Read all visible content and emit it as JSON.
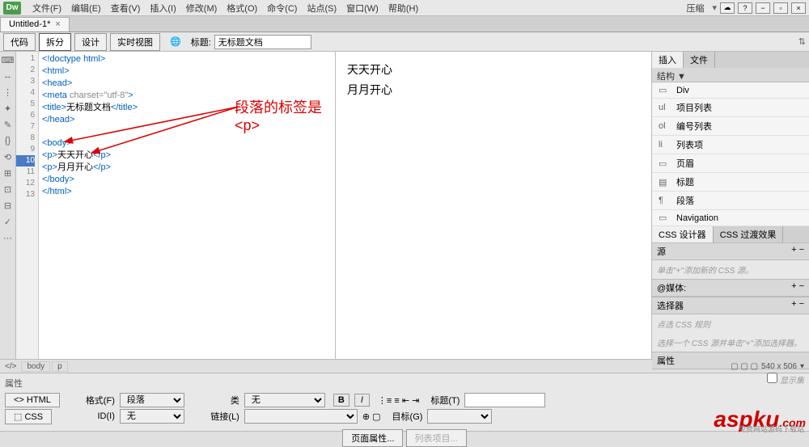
{
  "logo": "Dw",
  "menu": [
    "文件(F)",
    "编辑(E)",
    "查看(V)",
    "插入(I)",
    "修改(M)",
    "格式(O)",
    "命令(C)",
    "站点(S)",
    "窗口(W)",
    "帮助(H)"
  ],
  "compact": "压缩",
  "doc_tab": "Untitled-1*",
  "toolbar": {
    "code": "代码",
    "split": "拆分",
    "design": "设计",
    "live": "实时视图",
    "title_label": "标题:",
    "title_value": "无标题文档"
  },
  "code": {
    "lines": [
      "1",
      "2",
      "3",
      "4",
      "5",
      "6",
      "7",
      "8",
      "9",
      "10",
      "11",
      "12",
      "13"
    ],
    "l1": "<!doctype html>",
    "l2": "<html>",
    "l3": "<head>",
    "l4a": "<meta ",
    "l4b": "charset=\"utf-8\"",
    "l4c": ">",
    "l5a": "<title>",
    "l5b": "无标题文档",
    "l5c": "</title>",
    "l6": "</head>",
    "l8": "<body>",
    "l9a": "<p>",
    "l9b": "天天开心",
    "l9c": "</p>",
    "l10a": "<p>",
    "l10b": "月月开心",
    "l10c": "</p>",
    "l11": "</body>",
    "l12": "</html>"
  },
  "annotation": "段落的标签是<p>",
  "preview": {
    "p1": "天天开心",
    "p2": "月月开心"
  },
  "right": {
    "tabs": {
      "insert": "插入",
      "file": "文件"
    },
    "struct": "结构 ▼",
    "items": [
      {
        "icon": "▭",
        "label": "Div"
      },
      {
        "icon": "ul",
        "label": "项目列表"
      },
      {
        "icon": "ol",
        "label": "编号列表"
      },
      {
        "icon": "li",
        "label": "列表项"
      },
      {
        "icon": "▭",
        "label": "页眉"
      },
      {
        "icon": "▤",
        "label": "标题"
      },
      {
        "icon": "¶",
        "label": "段落"
      },
      {
        "icon": "▭",
        "label": "Navigation"
      }
    ],
    "css_tabs": {
      "designer": "CSS 设计器",
      "trans": "CSS 过渡效果"
    },
    "source": "源",
    "source_hint": "单击\"+\"添加新的 CSS 源。",
    "media": "@媒体:",
    "selector": "选择器",
    "selector_hint": "点选 CSS 规则",
    "selector_hint2": "选择一个 CSS 源并单击\"+\"添加选择器。",
    "props": "属性",
    "showset": "显示集"
  },
  "breadcrumb": {
    "body": "body",
    "p": "p",
    "size": "540 x 506"
  },
  "props": {
    "title": "属性",
    "html": "HTML",
    "css": "CSS",
    "format_l": "格式(F)",
    "format_v": "段落",
    "id_l": "ID(I)",
    "id_v": "无",
    "class_l": "类",
    "class_v": "无",
    "link_l": "链接(L)",
    "title_l": "标题(T)",
    "target_l": "目标(G)",
    "page_props": "页面属性...",
    "list_item": "列表项目..."
  },
  "watermark": "aspku",
  "watermark_com": ".com",
  "watermark_sub": "免费网站源码下载站"
}
